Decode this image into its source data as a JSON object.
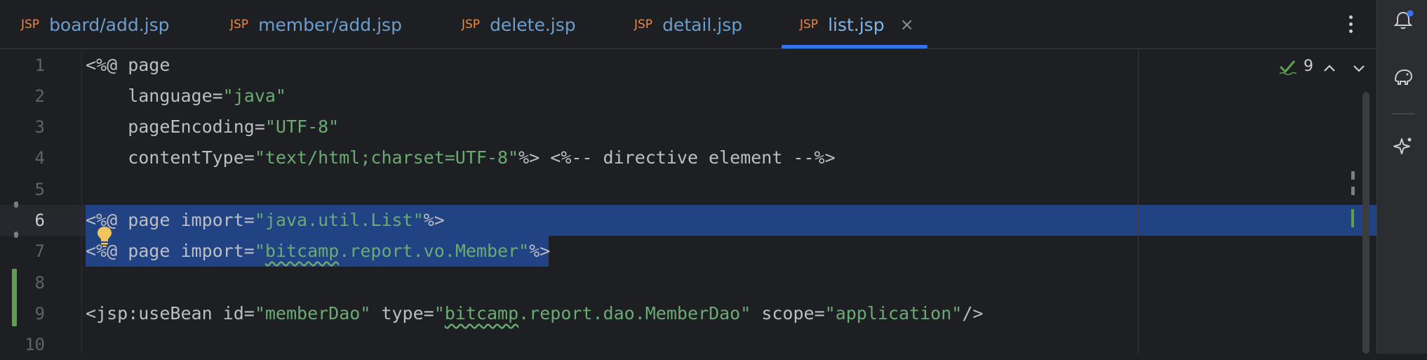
{
  "tabs": [
    {
      "type": "JSP",
      "label": "board/add.jsp",
      "active": false
    },
    {
      "type": "JSP",
      "label": "member/add.jsp",
      "active": false
    },
    {
      "type": "JSP",
      "label": "delete.jsp",
      "active": false
    },
    {
      "type": "JSP",
      "label": "detail.jsp",
      "active": false
    },
    {
      "type": "JSP",
      "label": "list.jsp",
      "active": true,
      "close": "×"
    }
  ],
  "editor": {
    "line_numbers": [
      "1",
      "2",
      "3",
      "4",
      "5",
      "6",
      "7",
      "8",
      "9",
      "10"
    ],
    "lines": {
      "l1_a": "<%@ page",
      "l2_a": "    language=",
      "l2_b": "\"java\"",
      "l3_a": "    pageEncoding=",
      "l3_b": "\"UTF-8\"",
      "l4_a": "    contentType=",
      "l4_b": "\"text/html;charset=UTF-8\"",
      "l4_c": "%> <%-- directive element --%>",
      "l6_a": "<%@ page import=",
      "l6_b": "\"java.util.List\"",
      "l6_c": "%>",
      "l7_a": "<%@ page import=",
      "l7_b": "\"",
      "l7_c": "bitcamp",
      "l7_d": ".report.vo.Member\"",
      "l7_e": "%>",
      "l9_a": "<jsp:useBean id=",
      "l9_b": "\"memberDao\"",
      "l9_c": " type=",
      "l9_d": "\"",
      "l9_e": "bitcamp",
      "l9_f": ".report.dao.MemberDao\"",
      "l9_g": " scope=",
      "l9_h": "\"application\"",
      "l9_i": "/>"
    },
    "inspection_count": "9"
  },
  "colors": {
    "string": "#6aab73",
    "selection": "#214283",
    "accent": "#3574f0",
    "tab_file_icon": "#e8884a"
  },
  "icons": {
    "more": "vertical-ellipsis-icon",
    "bulb": "lightbulb-icon",
    "inspection": "checkmark-icon",
    "notifications": "bell-icon",
    "database": "elephant-icon",
    "ai": "sparkle-icon"
  }
}
